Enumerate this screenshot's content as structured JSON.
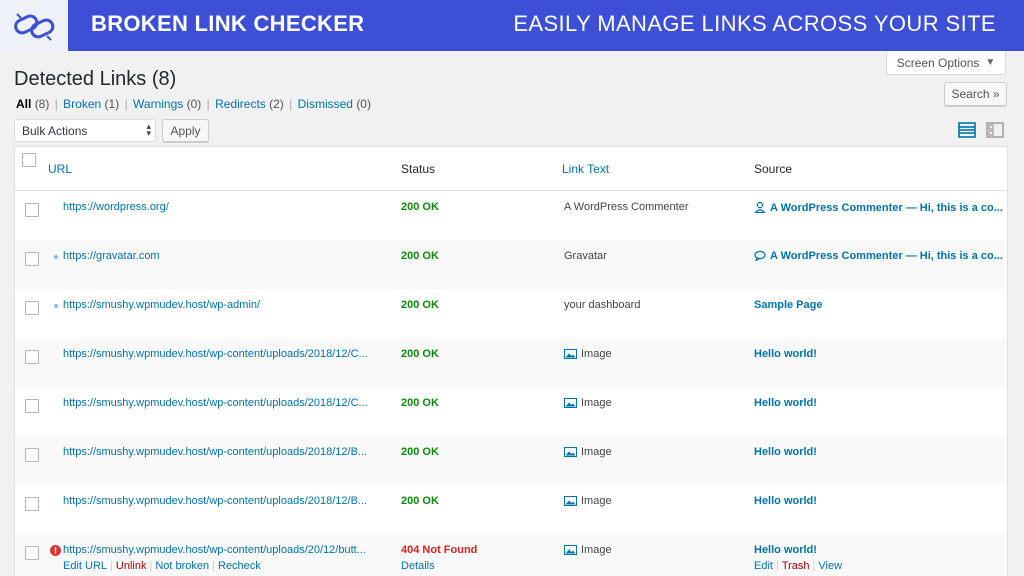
{
  "banner": {
    "title": "BROKEN LINK CHECKER",
    "tagline": "EASILY MANAGE LINKS ACROSS YOUR SITE",
    "logo_icon": "chain-link-icon"
  },
  "screen_options": {
    "label": "Screen Options",
    "arrow": "▼"
  },
  "page_title": "Detected Links (8)",
  "filters": [
    {
      "label": "All",
      "count": "(8)",
      "current": true
    },
    {
      "label": "Broken",
      "count": "(1)"
    },
    {
      "label": "Warnings",
      "count": "(0)"
    },
    {
      "label": "Redirects",
      "count": "(2)"
    },
    {
      "label": "Dismissed",
      "count": "(0)"
    }
  ],
  "search_button": "Search »",
  "bulk": {
    "selected": "Bulk Actions",
    "apply": "Apply"
  },
  "columns": {
    "url": "URL",
    "status": "Status",
    "link_text": "Link Text",
    "source": "Source"
  },
  "rows": [
    {
      "url": "https://wordpress.org/",
      "status": "200 OK",
      "link_text": "A WordPress Commenter",
      "source": "A WordPress Commenter — Hi, this is a co...",
      "source_icon": "user-icon"
    },
    {
      "url": "https://gravatar.com",
      "status": "200 OK",
      "link_text": "Gravatar",
      "source": "A WordPress Commenter — Hi, this is a co...",
      "source_icon": "comment-icon"
    },
    {
      "url": "https://smushy.wpmudev.host/wp-admin/",
      "status": "200 OK",
      "link_text": "your dashboard",
      "source": "Sample Page"
    },
    {
      "url": "https://smushy.wpmudev.host/wp-content/uploads/2018/12/C...",
      "status": "200 OK",
      "link_text": "Image",
      "source": "Hello world!",
      "text_icon": "image-icon"
    },
    {
      "url": "https://smushy.wpmudev.host/wp-content/uploads/2018/12/C...",
      "status": "200 OK",
      "link_text": "Image",
      "source": "Hello world!",
      "text_icon": "image-icon"
    },
    {
      "url": "https://smushy.wpmudev.host/wp-content/uploads/2018/12/B...",
      "status": "200 OK",
      "link_text": "Image",
      "source": "Hello world!",
      "text_icon": "image-icon"
    },
    {
      "url": "https://smushy.wpmudev.host/wp-content/uploads/2018/12/B...",
      "status": "200 OK",
      "link_text": "Image",
      "source": "Hello world!",
      "text_icon": "image-icon"
    },
    {
      "url": "https://smushy.wpmudev.host/wp-content/uploads/20/12/butt...",
      "status": "404 Not Found",
      "link_text": "Image",
      "source": "Hello world!",
      "text_icon": "image-icon",
      "url_icon": "error-icon"
    }
  ],
  "row_actions": {
    "url": [
      "Edit URL",
      "Unlink",
      "Not broken",
      "Recheck"
    ],
    "status": "Details",
    "source": [
      "Edit",
      "Trash",
      "View"
    ]
  },
  "colors": {
    "banner": "#3c4fd6",
    "link": "#0073aa",
    "ok": "#0a8a0a",
    "error": "#dc1f1f"
  }
}
